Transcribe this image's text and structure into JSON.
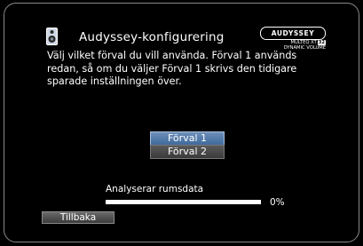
{
  "header": {
    "title": "Audyssey-konfigurering",
    "icon": "speaker-icon",
    "brand": {
      "name": "AUDYSSEY",
      "line1": "MULTEQ XT",
      "line1_badge": "32",
      "line2": "DYNAMIC VOLUME"
    }
  },
  "description": "Välj vilket förval du vill använda. Förval 1 används redan, så om du väljer  Förval 1 skrivs den tidigare sparade inställningen över.",
  "options": [
    {
      "label": "Förval 1",
      "selected": true
    },
    {
      "label": "Förval 2",
      "selected": false
    }
  ],
  "status": {
    "label": "Analyserar rumsdata",
    "progress_fraction": 0,
    "progress_text": "0%"
  },
  "footer": {
    "back_label": "Tillbaka"
  },
  "colors": {
    "background": "#000000",
    "text": "#ffffff",
    "selected_option": "#5b80af",
    "unselected_option": "#4a4a4a",
    "progress_track": "#ffffff"
  }
}
